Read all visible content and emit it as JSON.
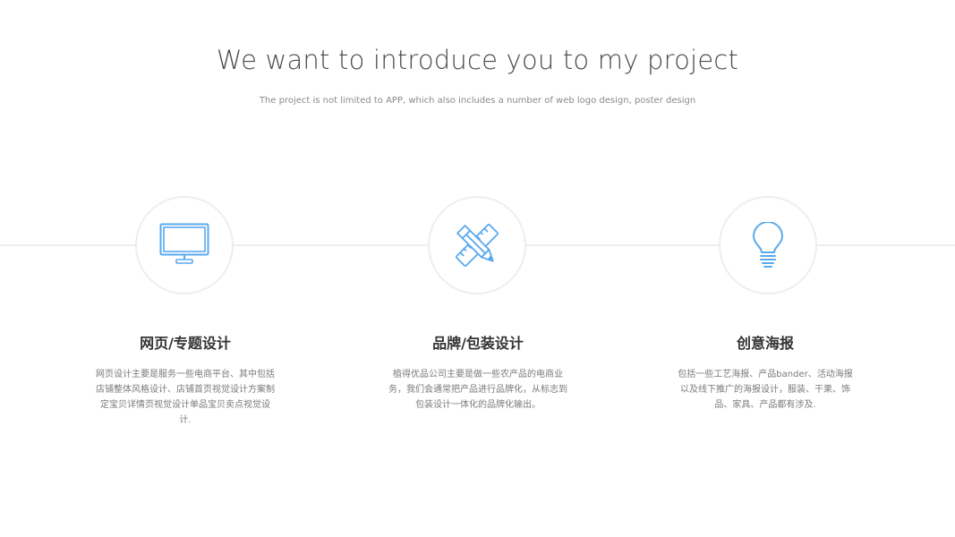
{
  "header": {
    "title": "We want to introduce you to my project",
    "subtitle": "The project is not limited to APP, which also includes a number of web logo design, poster design"
  },
  "colors": {
    "icon": "#5aa9ee",
    "connector": "#eeeeee",
    "circle_border": "#eeeeee",
    "title_text": "#4a4a4a",
    "body_text": "#7a7a7a"
  },
  "features": [
    {
      "icon": "monitor-icon",
      "title": "网页/专题设计",
      "description": "网页设计主要是服务一些电商平台、其中包括店铺整体风格设计、店铺首页视觉设计方案制定宝贝详情页视觉设计单品宝贝卖点视觉设计."
    },
    {
      "icon": "pencil-ruler-icon",
      "title": "品牌/包装设计",
      "description": "植得优品公司主要是做一些农产品的电商业务，我们会通常把产品进行品牌化，从标志到包装设计一体化的品牌化输出。"
    },
    {
      "icon": "lightbulb-icon",
      "title": "创意海报",
      "description": "包括一些工艺海报、产品bander、活动海报以及线下推广的海报设计，服装、干果、饰品、家具、产品都有涉及."
    }
  ]
}
